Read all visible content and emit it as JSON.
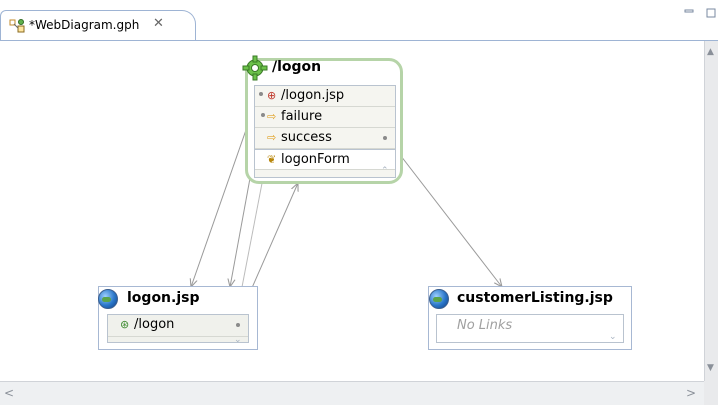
{
  "tab": {
    "title": "*WebDiagram.gph",
    "close_glyph": "✕",
    "icon": "diagram-file-icon"
  },
  "window_controls": [
    "minimize-icon",
    "maximize-icon"
  ],
  "scrollbars": {
    "left_arrow": "<",
    "right_arrow": ">",
    "up_arrow": "▲",
    "down_arrow": "▼"
  },
  "diagram": {
    "action_node": {
      "title": "/logon",
      "icon": "gear-icon",
      "rows": [
        {
          "label": "/logon.jsp",
          "icon": "input-link-icon"
        },
        {
          "label": "failure",
          "icon": "forward-icon"
        },
        {
          "label": "success",
          "icon": "forward-icon"
        },
        {
          "label": "logonForm",
          "icon": "form-bean-icon"
        }
      ]
    },
    "page_logon": {
      "title": "logon.jsp",
      "icon": "globe-icon",
      "rows": [
        {
          "label": "/logon",
          "icon": "link-icon"
        }
      ]
    },
    "page_customer": {
      "title": "customerListing.jsp",
      "icon": "globe-icon",
      "empty_text": "No Links"
    }
  },
  "colors": {
    "action_border": "#b6d4a8",
    "page_border": "#a7b8d3",
    "connector": "#9a9a9a",
    "tab_border": "#9eb4d4"
  }
}
